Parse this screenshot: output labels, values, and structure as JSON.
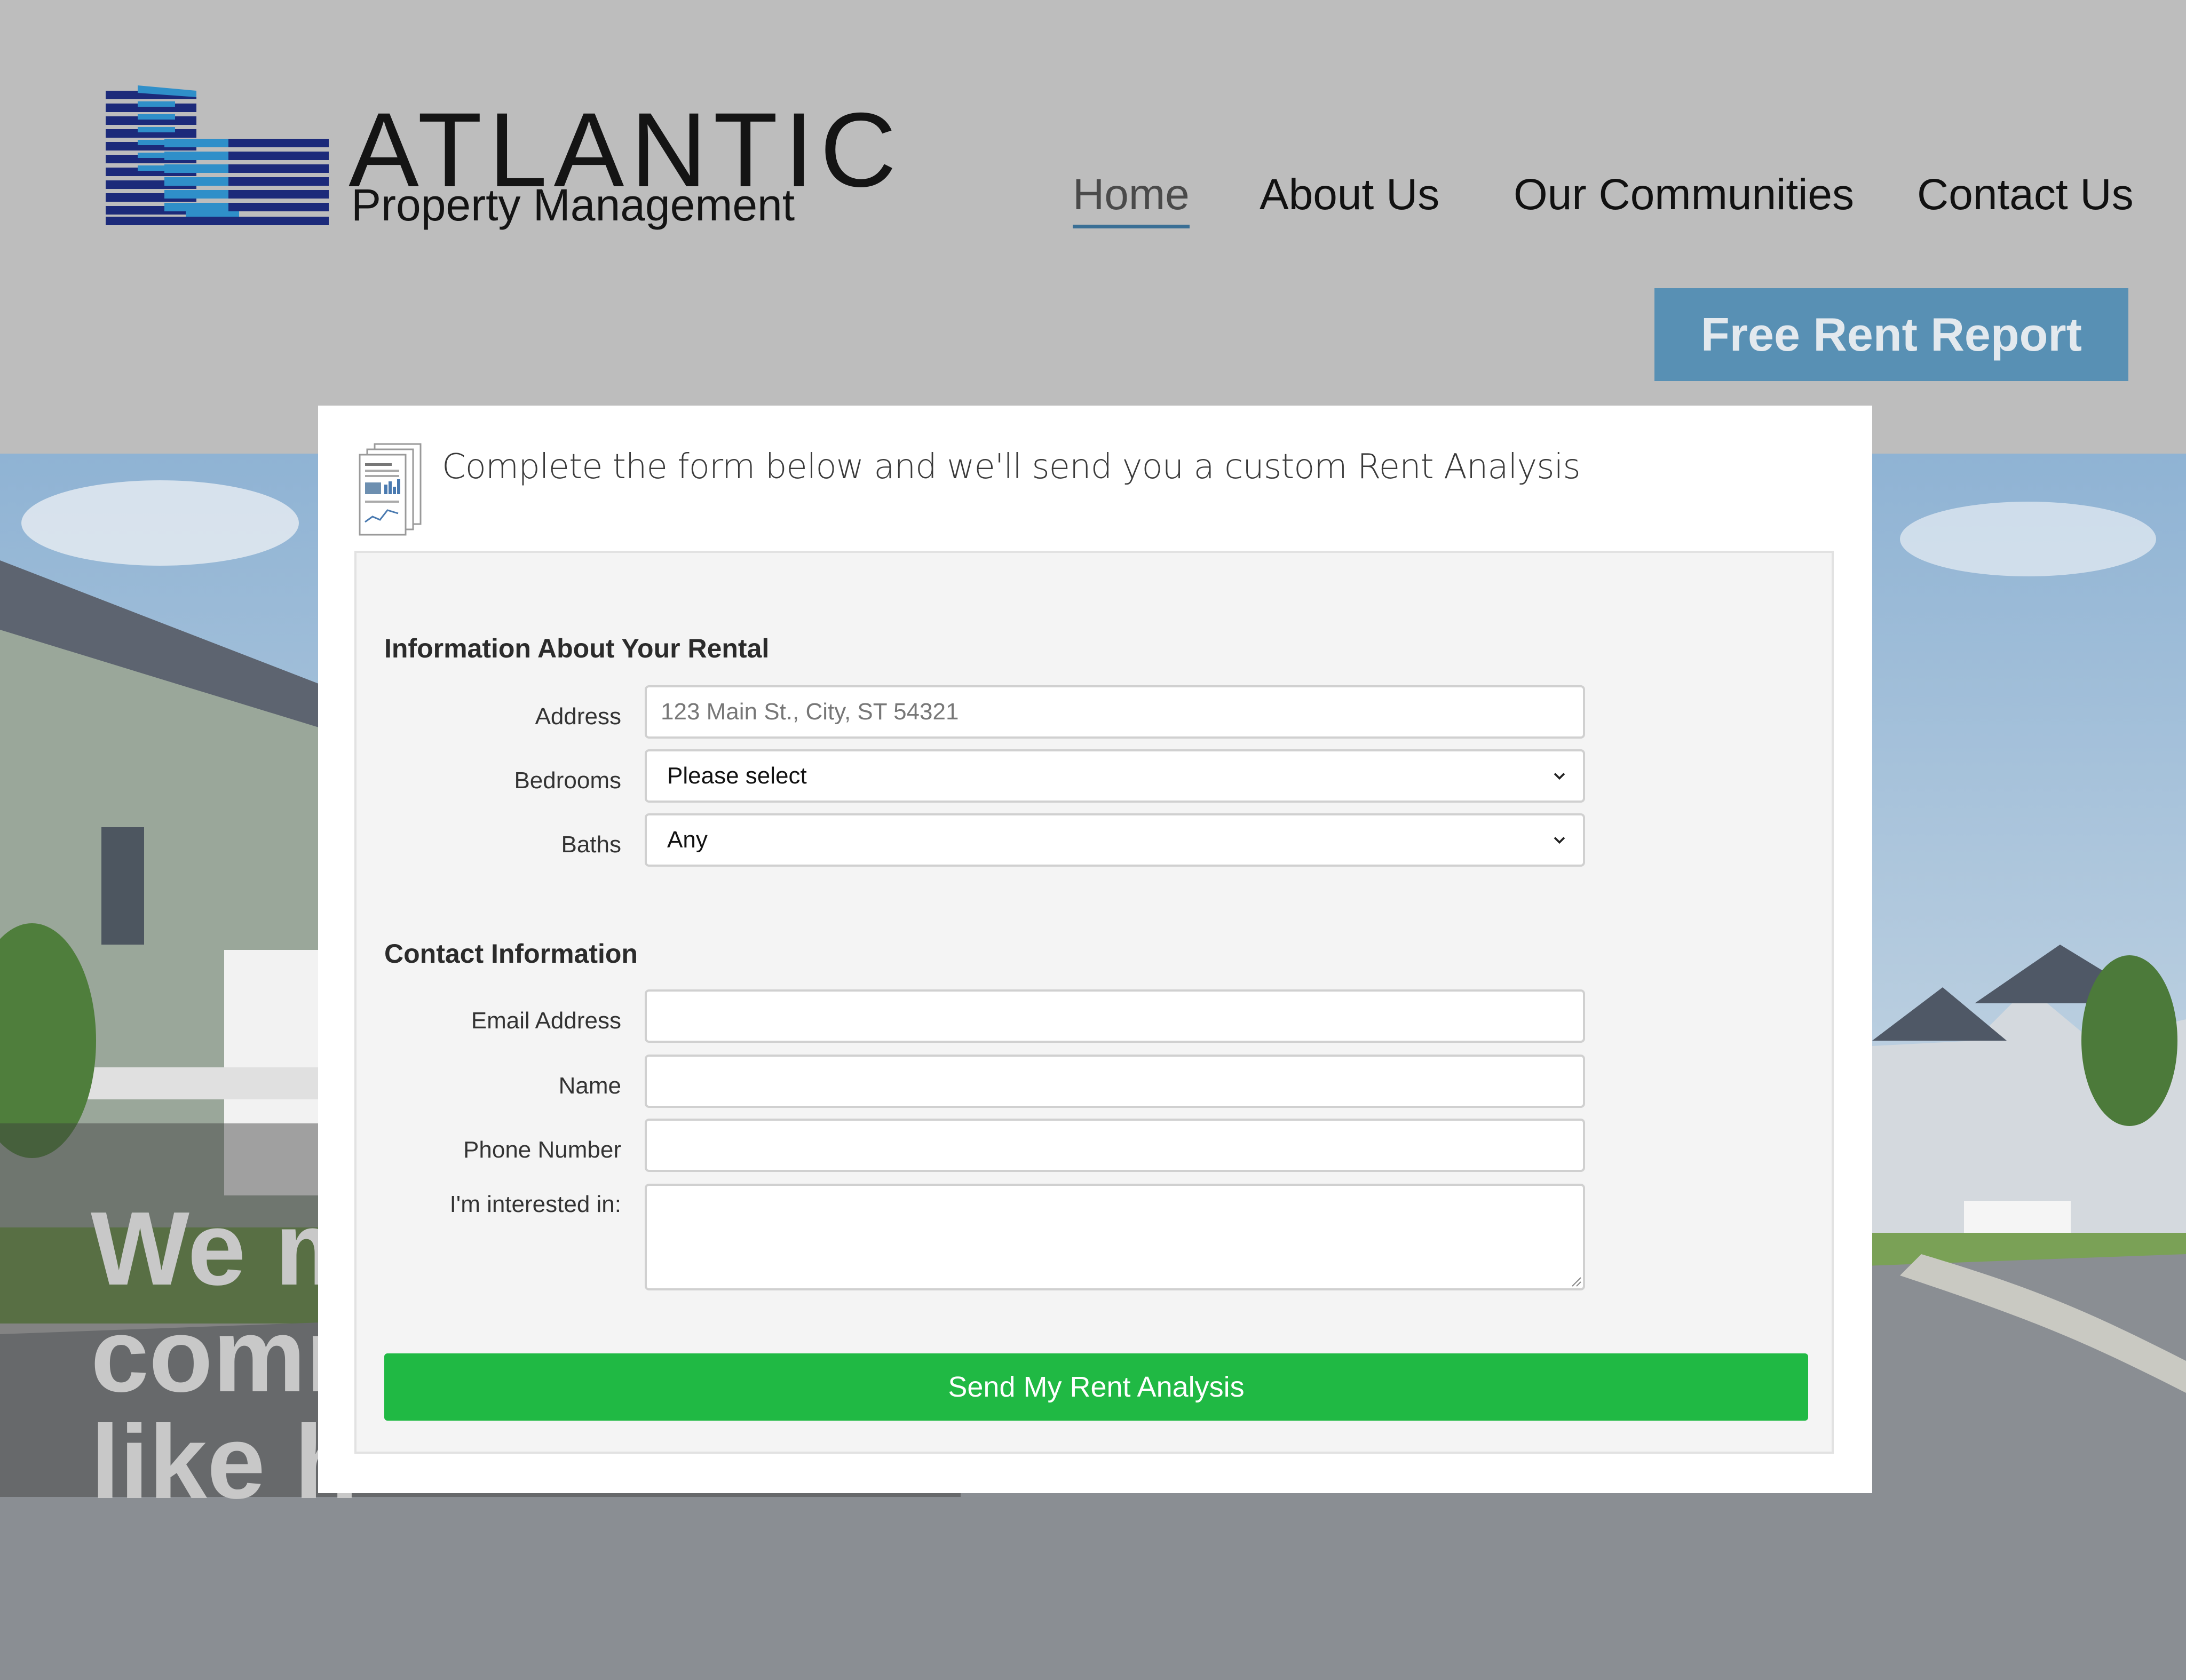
{
  "brand": {
    "name": "ATLANTIC",
    "tagline": "Property Management"
  },
  "nav": {
    "items": [
      {
        "label": "Home",
        "active": true
      },
      {
        "label": "About Us",
        "active": false
      },
      {
        "label": "Our Communities",
        "active": false
      },
      {
        "label": "Contact Us",
        "active": false
      }
    ]
  },
  "cta": {
    "label": "Free Rent Report"
  },
  "hero": {
    "lines": [
      "We m",
      "comm",
      "like h"
    ]
  },
  "modal": {
    "heading": "Complete the form below and we'll send you a custom Rent Analysis",
    "icon": "report-document-icon",
    "rental_section": {
      "title": "Information About Your Rental",
      "address": {
        "label": "Address",
        "placeholder": "123 Main St., City, ST 54321",
        "value": ""
      },
      "bedrooms": {
        "label": "Bedrooms",
        "value": "Please select"
      },
      "baths": {
        "label": "Baths",
        "value": "Any"
      }
    },
    "contact_section": {
      "title": "Contact Information",
      "email": {
        "label": "Email Address",
        "value": ""
      },
      "name": {
        "label": "Name",
        "value": ""
      },
      "phone": {
        "label": "Phone Number",
        "value": ""
      },
      "interest": {
        "label": "I'm interested in:",
        "value": ""
      }
    },
    "submit_label": "Send My Rent Analysis"
  },
  "colors": {
    "header_bg": "#bdbdbd",
    "cta_bg": "#5890b4",
    "nav_underline": "#3a6f95",
    "submit_bg": "#20b944",
    "logo_dark": "#1c2a7a",
    "logo_light": "#2f8fc9"
  }
}
